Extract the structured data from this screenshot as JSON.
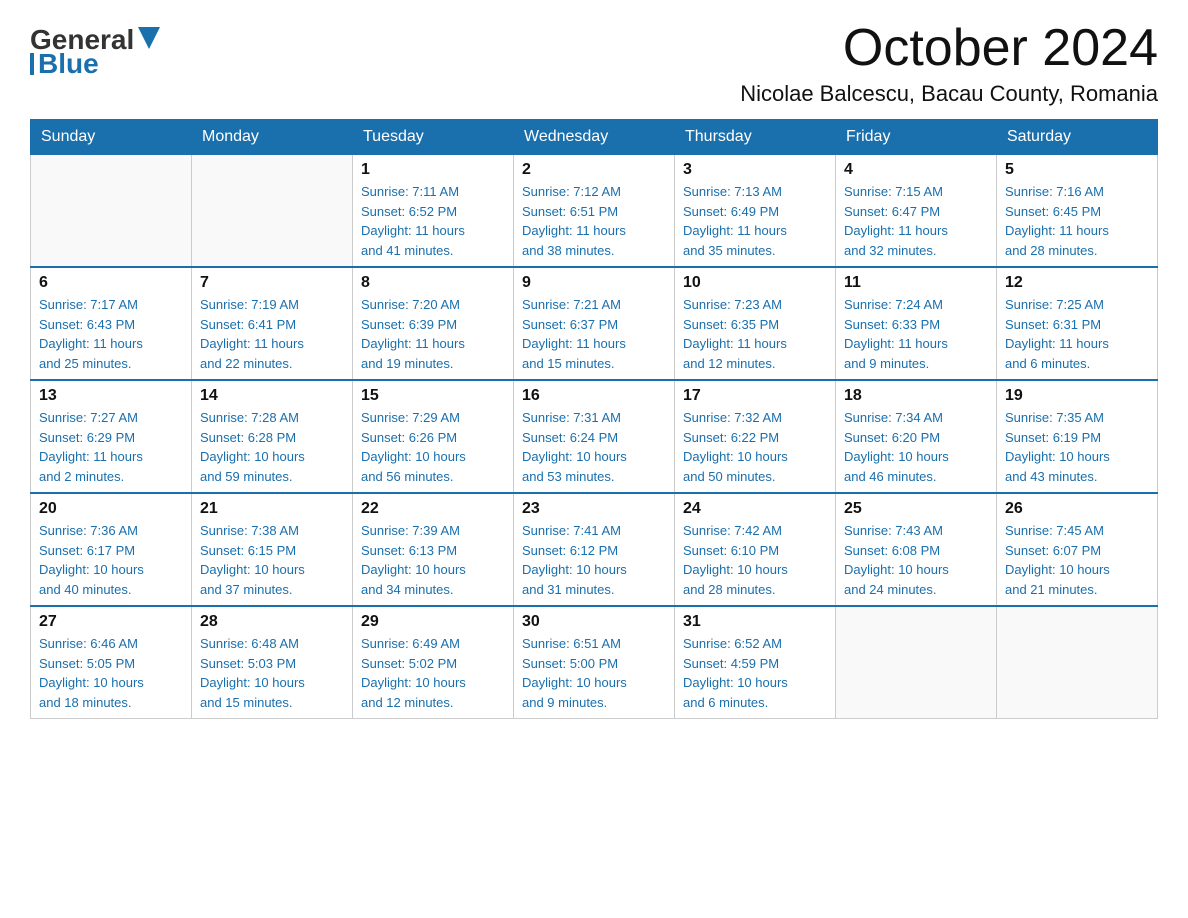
{
  "logo": {
    "general": "General",
    "blue": "Blue"
  },
  "title": "October 2024",
  "subtitle": "Nicolae Balcescu, Bacau County, Romania",
  "days_of_week": [
    "Sunday",
    "Monday",
    "Tuesday",
    "Wednesday",
    "Thursday",
    "Friday",
    "Saturday"
  ],
  "weeks": [
    [
      {
        "day": "",
        "info": ""
      },
      {
        "day": "",
        "info": ""
      },
      {
        "day": "1",
        "info": "Sunrise: 7:11 AM\nSunset: 6:52 PM\nDaylight: 11 hours\nand 41 minutes."
      },
      {
        "day": "2",
        "info": "Sunrise: 7:12 AM\nSunset: 6:51 PM\nDaylight: 11 hours\nand 38 minutes."
      },
      {
        "day": "3",
        "info": "Sunrise: 7:13 AM\nSunset: 6:49 PM\nDaylight: 11 hours\nand 35 minutes."
      },
      {
        "day": "4",
        "info": "Sunrise: 7:15 AM\nSunset: 6:47 PM\nDaylight: 11 hours\nand 32 minutes."
      },
      {
        "day": "5",
        "info": "Sunrise: 7:16 AM\nSunset: 6:45 PM\nDaylight: 11 hours\nand 28 minutes."
      }
    ],
    [
      {
        "day": "6",
        "info": "Sunrise: 7:17 AM\nSunset: 6:43 PM\nDaylight: 11 hours\nand 25 minutes."
      },
      {
        "day": "7",
        "info": "Sunrise: 7:19 AM\nSunset: 6:41 PM\nDaylight: 11 hours\nand 22 minutes."
      },
      {
        "day": "8",
        "info": "Sunrise: 7:20 AM\nSunset: 6:39 PM\nDaylight: 11 hours\nand 19 minutes."
      },
      {
        "day": "9",
        "info": "Sunrise: 7:21 AM\nSunset: 6:37 PM\nDaylight: 11 hours\nand 15 minutes."
      },
      {
        "day": "10",
        "info": "Sunrise: 7:23 AM\nSunset: 6:35 PM\nDaylight: 11 hours\nand 12 minutes."
      },
      {
        "day": "11",
        "info": "Sunrise: 7:24 AM\nSunset: 6:33 PM\nDaylight: 11 hours\nand 9 minutes."
      },
      {
        "day": "12",
        "info": "Sunrise: 7:25 AM\nSunset: 6:31 PM\nDaylight: 11 hours\nand 6 minutes."
      }
    ],
    [
      {
        "day": "13",
        "info": "Sunrise: 7:27 AM\nSunset: 6:29 PM\nDaylight: 11 hours\nand 2 minutes."
      },
      {
        "day": "14",
        "info": "Sunrise: 7:28 AM\nSunset: 6:28 PM\nDaylight: 10 hours\nand 59 minutes."
      },
      {
        "day": "15",
        "info": "Sunrise: 7:29 AM\nSunset: 6:26 PM\nDaylight: 10 hours\nand 56 minutes."
      },
      {
        "day": "16",
        "info": "Sunrise: 7:31 AM\nSunset: 6:24 PM\nDaylight: 10 hours\nand 53 minutes."
      },
      {
        "day": "17",
        "info": "Sunrise: 7:32 AM\nSunset: 6:22 PM\nDaylight: 10 hours\nand 50 minutes."
      },
      {
        "day": "18",
        "info": "Sunrise: 7:34 AM\nSunset: 6:20 PM\nDaylight: 10 hours\nand 46 minutes."
      },
      {
        "day": "19",
        "info": "Sunrise: 7:35 AM\nSunset: 6:19 PM\nDaylight: 10 hours\nand 43 minutes."
      }
    ],
    [
      {
        "day": "20",
        "info": "Sunrise: 7:36 AM\nSunset: 6:17 PM\nDaylight: 10 hours\nand 40 minutes."
      },
      {
        "day": "21",
        "info": "Sunrise: 7:38 AM\nSunset: 6:15 PM\nDaylight: 10 hours\nand 37 minutes."
      },
      {
        "day": "22",
        "info": "Sunrise: 7:39 AM\nSunset: 6:13 PM\nDaylight: 10 hours\nand 34 minutes."
      },
      {
        "day": "23",
        "info": "Sunrise: 7:41 AM\nSunset: 6:12 PM\nDaylight: 10 hours\nand 31 minutes."
      },
      {
        "day": "24",
        "info": "Sunrise: 7:42 AM\nSunset: 6:10 PM\nDaylight: 10 hours\nand 28 minutes."
      },
      {
        "day": "25",
        "info": "Sunrise: 7:43 AM\nSunset: 6:08 PM\nDaylight: 10 hours\nand 24 minutes."
      },
      {
        "day": "26",
        "info": "Sunrise: 7:45 AM\nSunset: 6:07 PM\nDaylight: 10 hours\nand 21 minutes."
      }
    ],
    [
      {
        "day": "27",
        "info": "Sunrise: 6:46 AM\nSunset: 5:05 PM\nDaylight: 10 hours\nand 18 minutes."
      },
      {
        "day": "28",
        "info": "Sunrise: 6:48 AM\nSunset: 5:03 PM\nDaylight: 10 hours\nand 15 minutes."
      },
      {
        "day": "29",
        "info": "Sunrise: 6:49 AM\nSunset: 5:02 PM\nDaylight: 10 hours\nand 12 minutes."
      },
      {
        "day": "30",
        "info": "Sunrise: 6:51 AM\nSunset: 5:00 PM\nDaylight: 10 hours\nand 9 minutes."
      },
      {
        "day": "31",
        "info": "Sunrise: 6:52 AM\nSunset: 4:59 PM\nDaylight: 10 hours\nand 6 minutes."
      },
      {
        "day": "",
        "info": ""
      },
      {
        "day": "",
        "info": ""
      }
    ]
  ]
}
